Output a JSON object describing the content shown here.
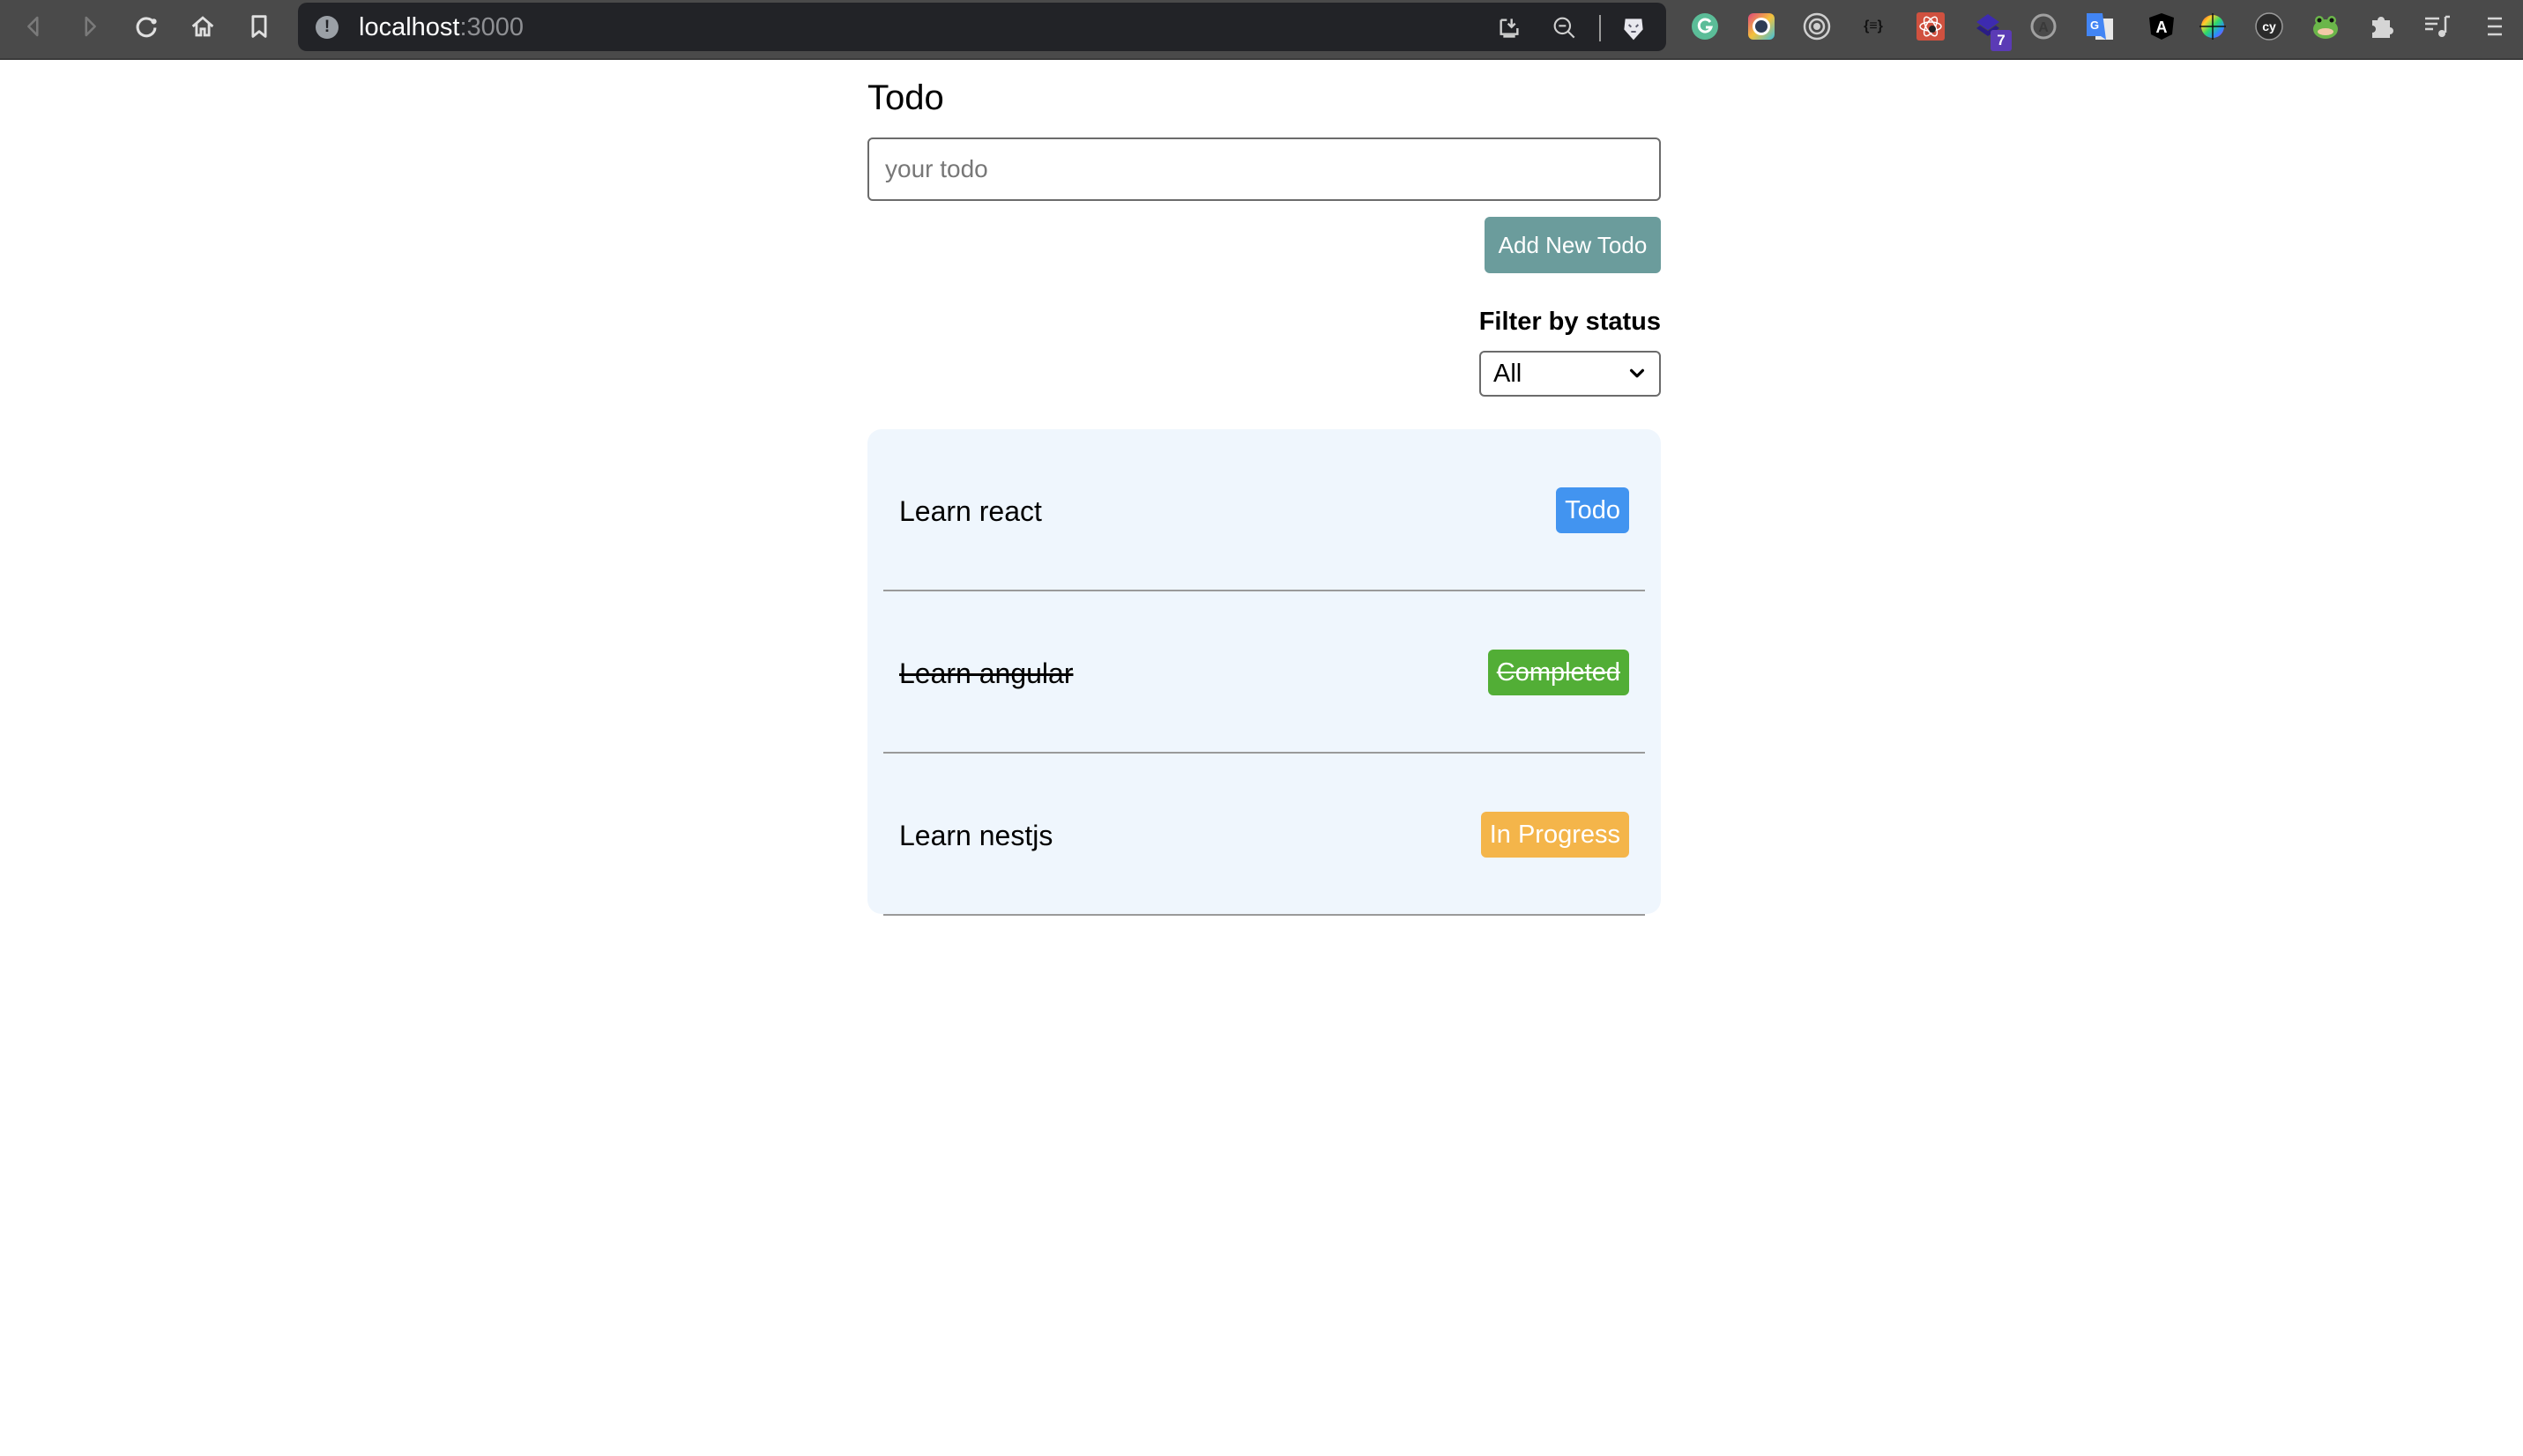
{
  "browser": {
    "url_host": "localhost",
    "url_port": ":3000",
    "nav": [
      "back",
      "forward",
      "reload",
      "home",
      "bookmark"
    ],
    "extensions": [
      {
        "name": "grammarly",
        "glyph": "G",
        "color": "#5bbd98"
      },
      {
        "name": "colorzilla",
        "glyph": "",
        "color": "#e0457b"
      },
      {
        "name": "ionic",
        "glyph": "",
        "color": "#cccccc"
      },
      {
        "name": "json-formatter",
        "glyph": "{≡}",
        "color": "#111111"
      },
      {
        "name": "react-devtools",
        "glyph": "⚛",
        "color": "#d0513f"
      },
      {
        "name": "layers",
        "glyph": "",
        "color": "#3d2bb0"
      },
      {
        "name": "augury",
        "glyph": "A",
        "color": "#9a9a9a"
      },
      {
        "name": "google-translate",
        "glyph": "G",
        "color": "#4285f4"
      },
      {
        "name": "angular-devtools",
        "glyph": "A",
        "color": "#000000"
      },
      {
        "name": "color-picker",
        "glyph": "",
        "color": "#ff0000"
      },
      {
        "name": "cypress",
        "glyph": "cy",
        "color": "#2b2b2b"
      },
      {
        "name": "frog",
        "glyph": "🐸",
        "color": "#6bb64a"
      }
    ],
    "extension_badge": "7"
  },
  "app": {
    "title": "Todo",
    "input": {
      "value": "",
      "placeholder": "your todo"
    },
    "add_button_label": "Add New Todo",
    "filter": {
      "label": "Filter by status",
      "selected": "All"
    },
    "todos": [
      {
        "text": "Learn react",
        "status": "Todo",
        "completed": false,
        "color": "#4294f0"
      },
      {
        "text": "Learn angular",
        "status": "Completed",
        "completed": true,
        "color": "#52ae36"
      },
      {
        "text": "Learn nestjs",
        "status": "In Progress",
        "completed": false,
        "color": "#f4b54a"
      }
    ]
  }
}
